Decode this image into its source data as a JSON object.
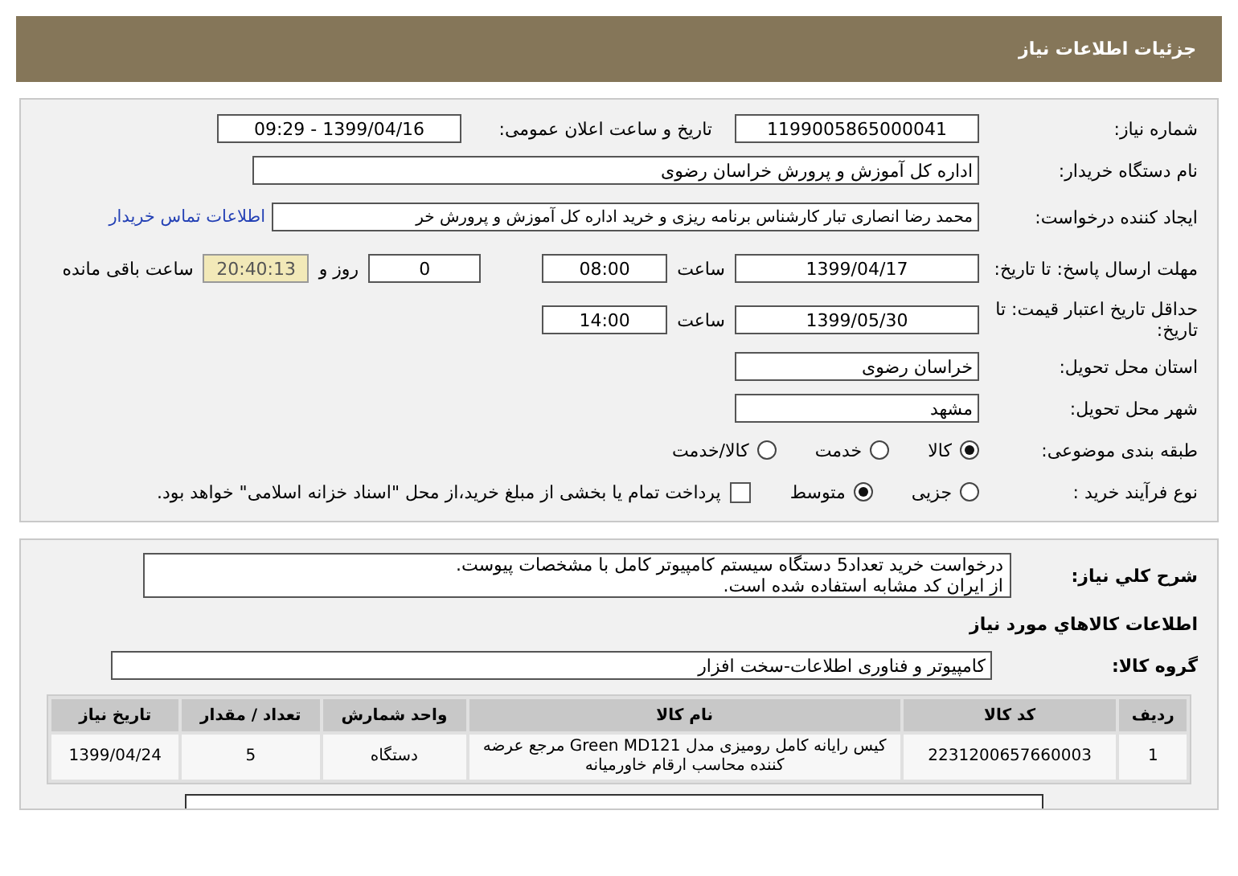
{
  "header": {
    "title": "جزئیات اطلاعات نیاز"
  },
  "need_number": {
    "label": "شماره نیاز:",
    "value": "1199005865000041"
  },
  "announce": {
    "label": "تاریخ و ساعت اعلان عمومی:",
    "value": "1399/04/16 - 09:29"
  },
  "buyer": {
    "label": "نام دستگاه خریدار:",
    "value": "اداره کل آموزش و پرورش خراسان رضوی"
  },
  "creator": {
    "label": "ایجاد کننده درخواست:",
    "value": "محمد رضا انصاری تبار کارشناس برنامه ریزی و خرید اداره کل آموزش و پرورش خر",
    "link": "اطلاعات تماس خریدار"
  },
  "deadline": {
    "label": "مهلت ارسال پاسخ: تا تاریخ:",
    "date": "1399/04/17",
    "time_label": "ساعت",
    "time": "08:00",
    "days": "0",
    "days_suffix": "روز و",
    "remaining": "20:40:13",
    "remaining_suffix": "ساعت باقی مانده"
  },
  "validity": {
    "label": "حداقل تاریخ اعتبار قیمت: تا تاریخ:",
    "date": "1399/05/30",
    "time_label": "ساعت",
    "time": "14:00"
  },
  "province": {
    "label": "استان محل تحویل:",
    "value": "خراسان رضوی"
  },
  "city": {
    "label": "شهر محل تحویل:",
    "value": "مشهد"
  },
  "category": {
    "label": "طبقه بندی موضوعی:",
    "options": [
      {
        "label": "کالا",
        "selected": true
      },
      {
        "label": "خدمت",
        "selected": false
      },
      {
        "label": "کالا/خدمت",
        "selected": false
      }
    ]
  },
  "process": {
    "label": "نوع فرآیند خرید :",
    "options": [
      {
        "label": "جزیی",
        "selected": false
      },
      {
        "label": "متوسط",
        "selected": true
      }
    ],
    "treasury": {
      "label": "پرداخت تمام یا بخشی از مبلغ خرید،از محل \"اسناد خزانه اسلامی\" خواهد بود.",
      "checked": false
    }
  },
  "description": {
    "label": "شرح کلي نياز:",
    "lines": [
      "درخواست خرید تعداد5 دستگاه سیستم کامپیوتر کامل با مشخصات پیوست.",
      "از ایران کد مشابه استفاده شده است."
    ]
  },
  "goods_title": "اطلاعات کالاهاي مورد نياز",
  "group": {
    "label": "گروه کالا:",
    "value": "کامپیوتر و فناوری اطلاعات-سخت افزار"
  },
  "table": {
    "columns": [
      "ردیف",
      "کد کالا",
      "نام کالا",
      "واحد شمارش",
      "تعداد / مقدار",
      "تاریخ نیاز"
    ],
    "rows": [
      [
        "1",
        "2231200657660003",
        "کیس رایانه کامل رومیزی مدل Green MD121 مرجع عرضه کننده محاسب ارقام خاورمیانه",
        "دستگاه",
        "5",
        "1399/04/24"
      ]
    ]
  }
}
